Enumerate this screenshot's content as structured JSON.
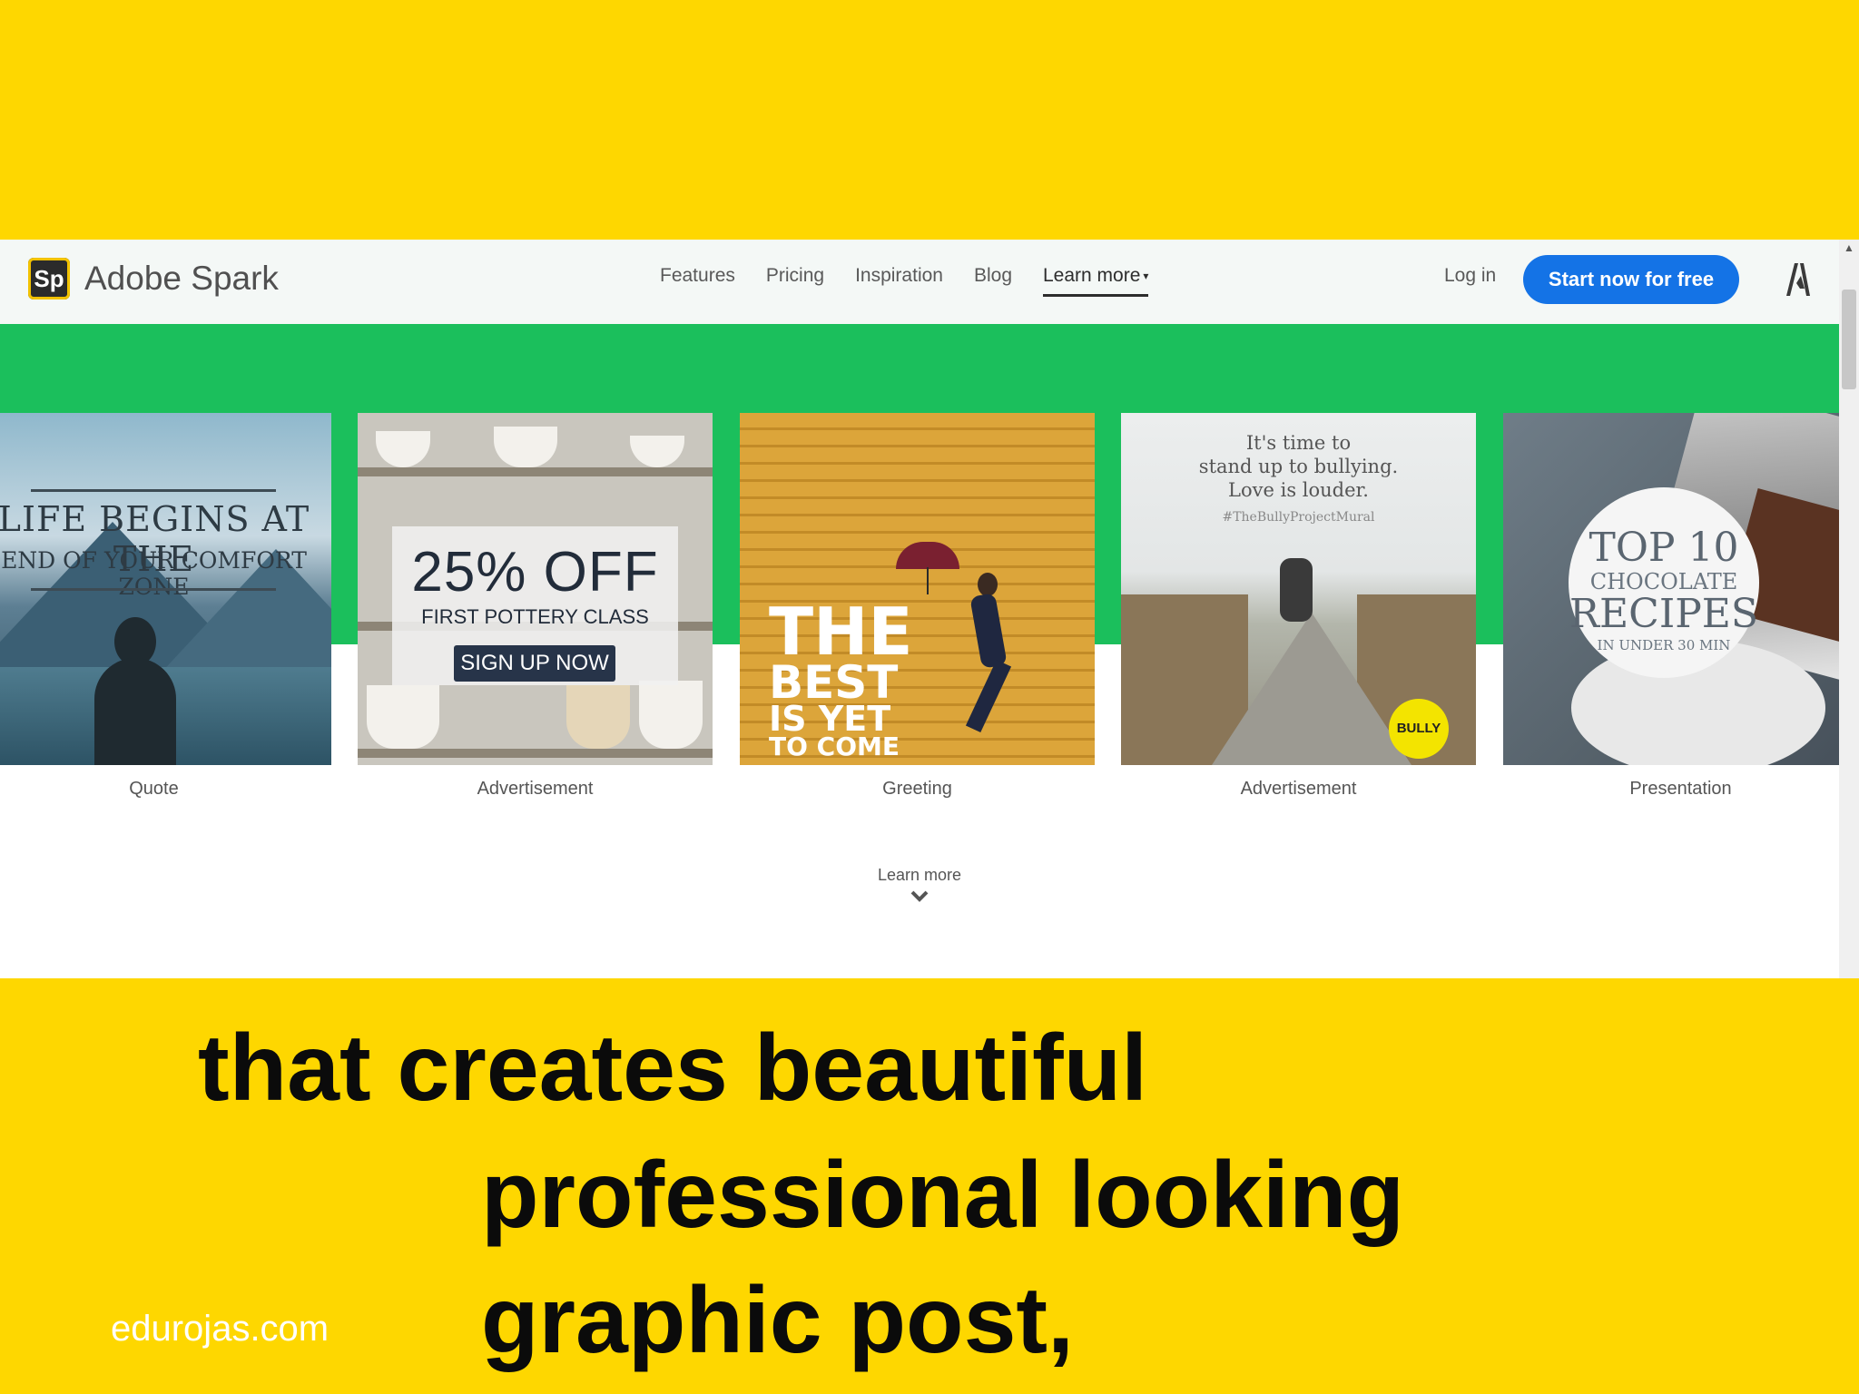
{
  "header": {
    "logo_mark": "Sp",
    "logo_text": "Adobe Spark",
    "nav": [
      "Features",
      "Pricing",
      "Inspiration",
      "Blog"
    ],
    "learn_more": "Learn more",
    "login": "Log in",
    "cta": "Start now for free"
  },
  "cards": [
    {
      "label": "Quote",
      "text": [
        "LIFE BEGINS AT THE",
        "END OF YOUR COMFORT ZONE"
      ]
    },
    {
      "label": "Advertisement",
      "text": [
        "25% OFF",
        "FIRST POTTERY CLASS",
        "SIGN UP NOW"
      ]
    },
    {
      "label": "Greeting",
      "text": [
        "THE",
        "BEST",
        "IS YET",
        "TO COME"
      ]
    },
    {
      "label": "Advertisement",
      "text": [
        "It's time to",
        "stand up to bullying.",
        "Love is louder.",
        "#TheBullyProjectMural",
        "BULLY"
      ]
    },
    {
      "label": "Presentation",
      "text": [
        "TOP 10",
        "CHOCOLATE",
        "RECIPES",
        "IN UNDER 30 MIN"
      ]
    }
  ],
  "learn_more_bottom": "Learn more",
  "caption": {
    "line1": "that creates beautiful",
    "line2": "professional  looking",
    "line3": "graphic post,"
  },
  "site": "edurojas.com",
  "colors": {
    "slide_bg": "#FED700",
    "band": "#1BBF5C",
    "cta": "#1473E6"
  }
}
